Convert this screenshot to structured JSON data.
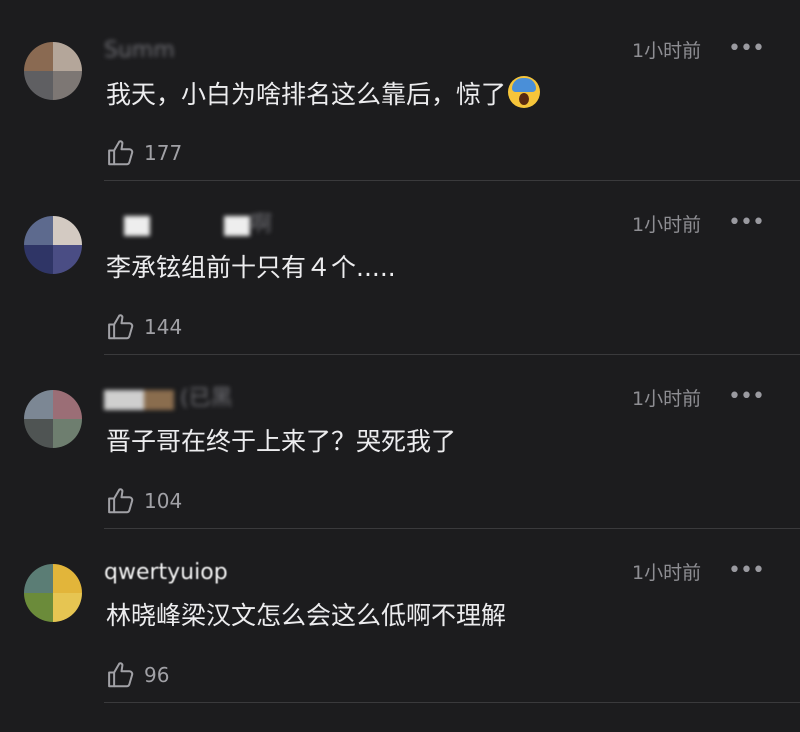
{
  "comments": [
    {
      "username": "Summ",
      "time": "1小时前",
      "more": "•••",
      "text": "我天，小白为啥排名这么靠后，惊了",
      "emoji": "screaming-face-emoji",
      "likes": "177",
      "avatar_colors": [
        "#8a6a52",
        "#b4a69a",
        "#5f5f62",
        "#7d7774"
      ]
    },
    {
      "username": "啊",
      "time": "1小时前",
      "more": "•••",
      "text": "李承铉组前十只有４个.....",
      "likes": "144",
      "avatar_colors": [
        "#5d6a8e",
        "#d3cac2",
        "#2f3566",
        "#4a4d84"
      ]
    },
    {
      "username": "(已黑",
      "time": "1小时前",
      "more": "•••",
      "text": "晋子哥在终于上来了？哭死我了",
      "likes": "104",
      "avatar_colors": [
        "#7c8794",
        "#9b6e76",
        "#4f5453",
        "#6e7e6f"
      ]
    },
    {
      "username": "qwertyuiop",
      "time": "1小时前",
      "more": "•••",
      "text": "林晓峰梁汉文怎么会这么低啊不理解",
      "likes": "96",
      "avatar_colors": [
        "#5b7d75",
        "#e2b53a",
        "#6b8b3a",
        "#e6c552"
      ]
    }
  ]
}
